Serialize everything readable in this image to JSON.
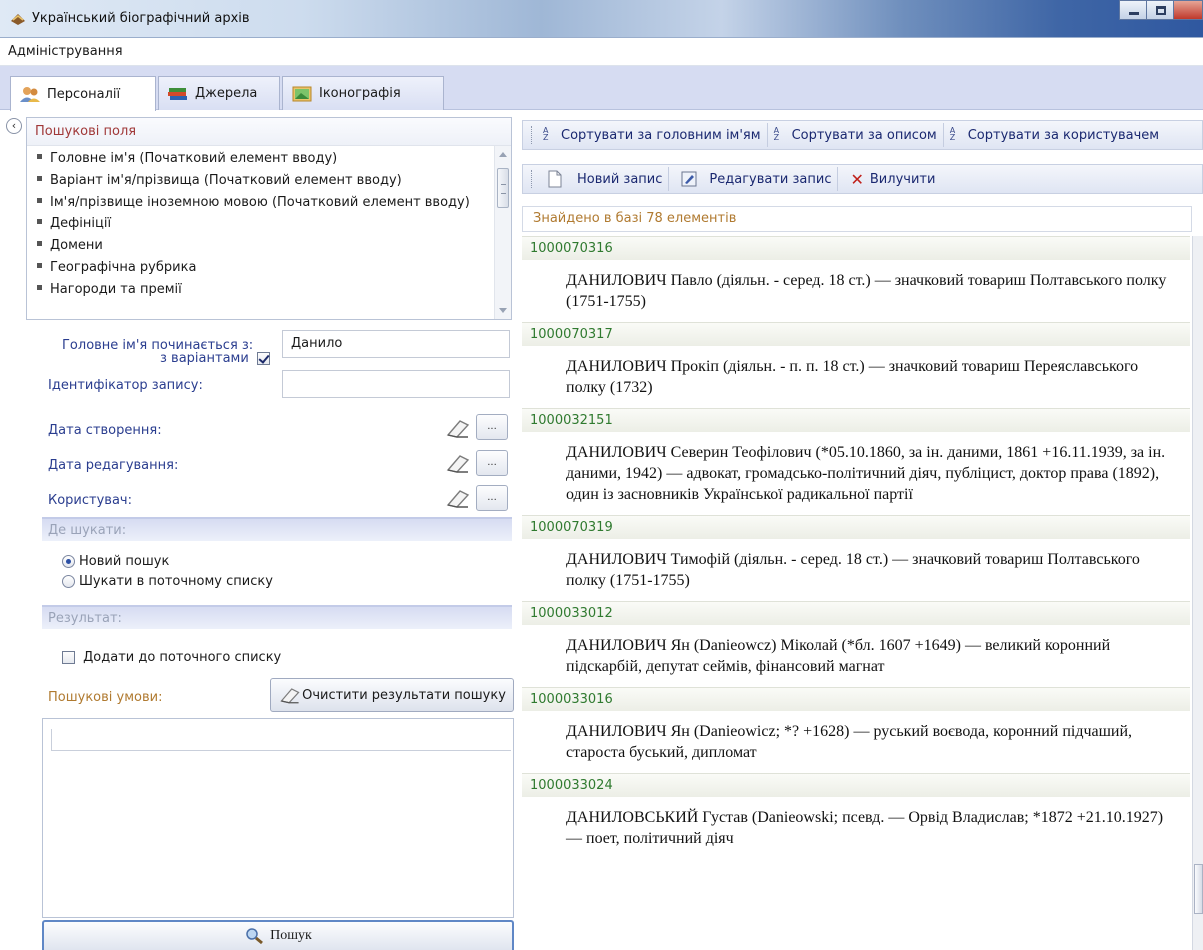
{
  "window": {
    "title": "Український біографічний архів"
  },
  "menu": {
    "admin_label": "Адміністрування"
  },
  "tabs": [
    {
      "label": "Персоналії",
      "icon": "people-icon",
      "active": true
    },
    {
      "label": "Джерела",
      "icon": "books-icon",
      "active": false
    },
    {
      "label": "Іконографія",
      "icon": "picture-icon",
      "active": false
    }
  ],
  "search_fields": {
    "header": "Пошукові поля",
    "items": [
      "Головне ім'я (Початковий елемент вводу)",
      "Варіант ім'я/прізвища (Початковий елемент вводу)",
      "Ім'я/прізвище іноземною мовою (Початковий елемент вводу)",
      "Дефініції",
      "Домени",
      "Географічна рубрика",
      "Нагороди та премії"
    ]
  },
  "form": {
    "main_name_label": "Головне ім'я починається з:",
    "with_variants_label": "з варіантами",
    "with_variants_checked": true,
    "main_name_value": "Данило",
    "record_id_label": "Ідентифікатор запису:",
    "record_id_value": "",
    "created_label": "Дата створення:",
    "edited_label": "Дата редагування:",
    "user_label": "Користувач:",
    "dots_label": "..."
  },
  "where": {
    "header": "Де шукати:",
    "options": [
      "Новий пошук",
      "Шукати в поточному списку"
    ],
    "selected": 0
  },
  "result": {
    "header": "Результат:",
    "add_to_list_label": "Додати до поточного списку",
    "add_to_list_checked": false
  },
  "conditions": {
    "label": "Пошукові умови:",
    "clear_button": "Очистити результати пошуку"
  },
  "search_button": "Пошук",
  "sort_toolbar": {
    "by_main_name": "Сортувати за головним ім'ям",
    "by_description": "Сортувати за описом",
    "by_user": "Сортувати за користувачем"
  },
  "edit_toolbar": {
    "new_record": "Новий запис",
    "edit_record": "Редагувати запис",
    "delete": "Вилучити"
  },
  "found_text": "Знайдено в базі 78 елементів",
  "records": [
    {
      "id": "1000070316",
      "text": "ДАНИЛОВИЧ Павло (діяльн. - серед. 18 ст.) — значковий товариш Полтавського полку (1751-1755)"
    },
    {
      "id": "1000070317",
      "text": "ДАНИЛОВИЧ Прокіп (діяльн. - п. п. 18 ст.) — значковий товариш Переяславського полку (1732)"
    },
    {
      "id": "1000032151",
      "text": "ДАНИЛОВИЧ Северин Теофілович (*05.10.1860, за ін. даними, 1861 +16.11.1939, за ін. даними, 1942) — адвокат, громадсько-політичний діяч, публіцист, доктор права (1892), один із засновників Української радикальної партії"
    },
    {
      "id": "1000070319",
      "text": "ДАНИЛОВИЧ Тимофій (діяльн. - серед. 18 ст.) — значковий товариш Полтавського полку (1751-1755)"
    },
    {
      "id": "1000033012",
      "text": "ДАНИЛОВИЧ Ян (Danieowcz) Міколай (*бл. 1607 +1649) — великий коронний підскарбій, депутат сеймів, фінансовий магнат"
    },
    {
      "id": "1000033016",
      "text": "ДАНИЛОВИЧ Ян (Danieowicz; *? +1628) — руський воєвода, коронний підчаший, староста буський, дипломат"
    },
    {
      "id": "1000033024",
      "text": "ДАНИЛОВСЬКИЙ Густав (Danieowski; псевд. — Орвід Владислав; *1872 +21.10.1927) — поет, політичний діяч"
    }
  ],
  "colors": {
    "label_blue": "#2a3d8f",
    "record_id_green": "#2f7a2f",
    "header_red": "#a03838",
    "found_orange": "#b07a30",
    "delete_red": "#c0201a"
  }
}
